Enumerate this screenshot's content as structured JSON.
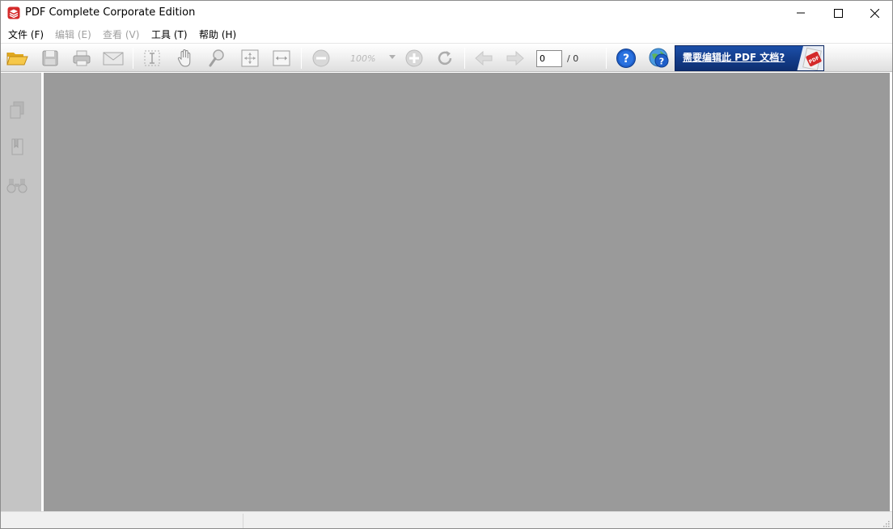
{
  "window": {
    "title": "PDF Complete Corporate Edition"
  },
  "menu": [
    {
      "label": "文件 (F)",
      "enabled": true
    },
    {
      "label": "编辑 (E)",
      "enabled": false
    },
    {
      "label": "查看 (V)",
      "enabled": false
    },
    {
      "label": "工具 (T)",
      "enabled": true
    },
    {
      "label": "帮助 (H)",
      "enabled": true
    }
  ],
  "toolbar": {
    "zoom_value": "100%",
    "page_current": "0",
    "page_total": "/ 0",
    "ad_text": "需要编辑此 PDF 文档?",
    "ad_badge": "PDF"
  },
  "icons": {
    "open": "folder-open-icon",
    "save": "save-icon",
    "print": "print-icon",
    "email": "email-icon",
    "select": "select-text-icon",
    "hand": "hand-icon",
    "zoom": "magnifier-icon",
    "fit_page": "fit-page-icon",
    "fit_width": "fit-width-icon",
    "zoom_out": "zoom-out-icon",
    "zoom_in": "zoom-in-icon",
    "rotate": "rotate-icon",
    "prev": "prev-page-icon",
    "next": "next-page-icon",
    "help": "help-icon",
    "web_help": "web-help-icon",
    "pages_panel": "pages-panel-icon",
    "bookmarks_panel": "bookmarks-panel-icon",
    "search_panel": "search-binoculars-icon"
  },
  "colors": {
    "document_background": "#9a9a9a",
    "side_panel": "#c4c4c4",
    "ad_banner": "#1c4fa8",
    "app_icon": "#d42a2a"
  }
}
